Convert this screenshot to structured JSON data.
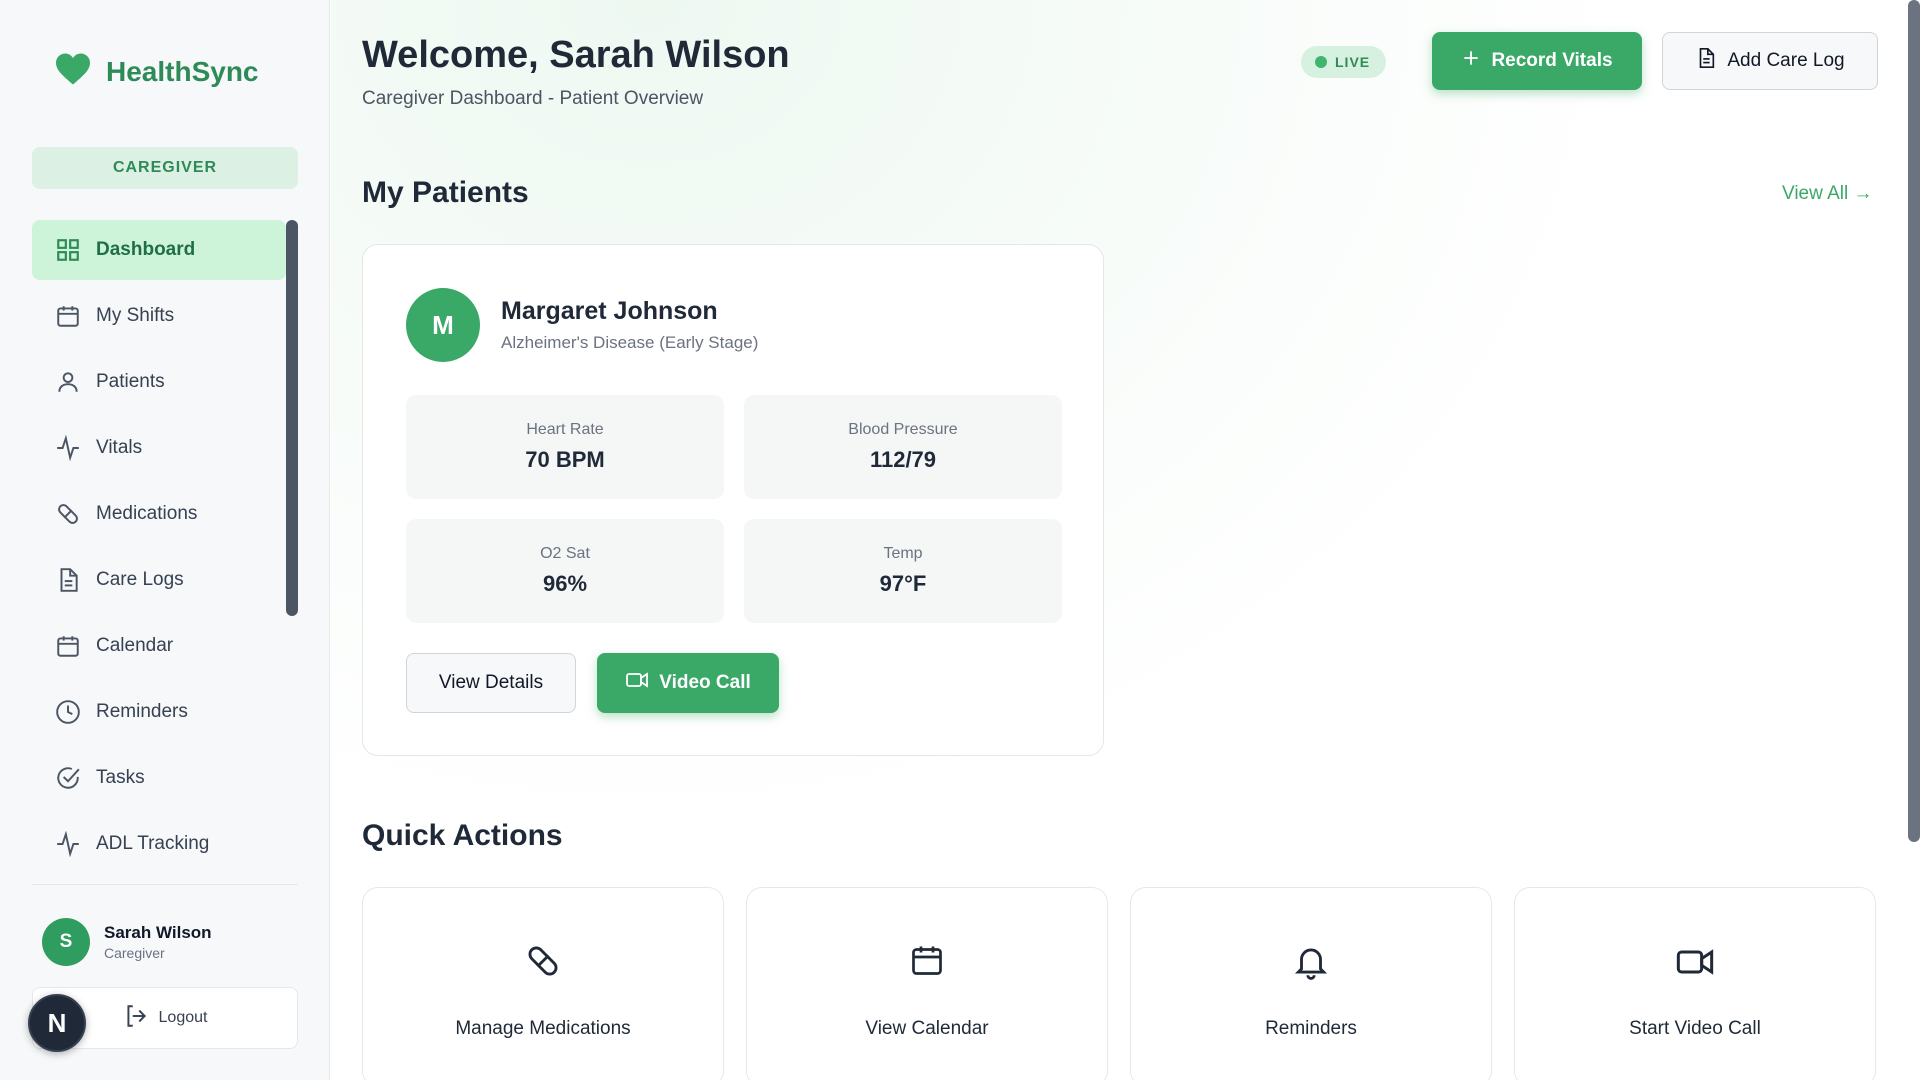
{
  "brand": {
    "name": "HealthSync"
  },
  "sidebar": {
    "role": "CAREGIVER",
    "items": [
      {
        "label": "Dashboard",
        "icon": "grid-icon"
      },
      {
        "label": "My Shifts",
        "icon": "calendar-icon"
      },
      {
        "label": "Patients",
        "icon": "user-icon"
      },
      {
        "label": "Vitals",
        "icon": "activity-icon"
      },
      {
        "label": "Medications",
        "icon": "pill-icon"
      },
      {
        "label": "Care Logs",
        "icon": "file-text-icon"
      },
      {
        "label": "Calendar",
        "icon": "calendar-icon"
      },
      {
        "label": "Reminders",
        "icon": "clock-icon"
      },
      {
        "label": "Tasks",
        "icon": "check-circle-icon"
      },
      {
        "label": "ADL Tracking",
        "icon": "activity-icon"
      }
    ],
    "user": {
      "initial": "S",
      "name": "Sarah Wilson",
      "role": "Caregiver"
    },
    "logout_label": "Logout",
    "n_badge": "N"
  },
  "header": {
    "welcome": "Welcome, Sarah Wilson",
    "subtitle": "Caregiver Dashboard - Patient Overview",
    "live_label": "LIVE",
    "record_vitals_label": "Record Vitals",
    "add_care_log_label": "Add Care Log"
  },
  "patients": {
    "title": "My Patients",
    "view_all_label": "View All →",
    "card": {
      "initial": "M",
      "name": "Margaret Johnson",
      "condition": "Alzheimer's Disease (Early Stage)",
      "vitals": [
        {
          "label": "Heart Rate",
          "value": "70 BPM"
        },
        {
          "label": "Blood Pressure",
          "value": "112/79"
        },
        {
          "label": "O2 Sat",
          "value": "96%"
        },
        {
          "label": "Temp",
          "value": "97°F"
        }
      ],
      "view_details_label": "View Details",
      "video_call_label": "Video Call"
    }
  },
  "quick_actions": {
    "title": "Quick Actions",
    "items": [
      {
        "label": "Manage Medications",
        "icon": "pill-icon"
      },
      {
        "label": "View Calendar",
        "icon": "calendar-icon"
      },
      {
        "label": "Reminders",
        "icon": "bell-icon"
      },
      {
        "label": "Start Video Call",
        "icon": "video-icon"
      }
    ]
  },
  "colors": {
    "accent": "#3aa867",
    "brand": "#2e8b57",
    "active_nav_bg": "#cdf3d9"
  }
}
